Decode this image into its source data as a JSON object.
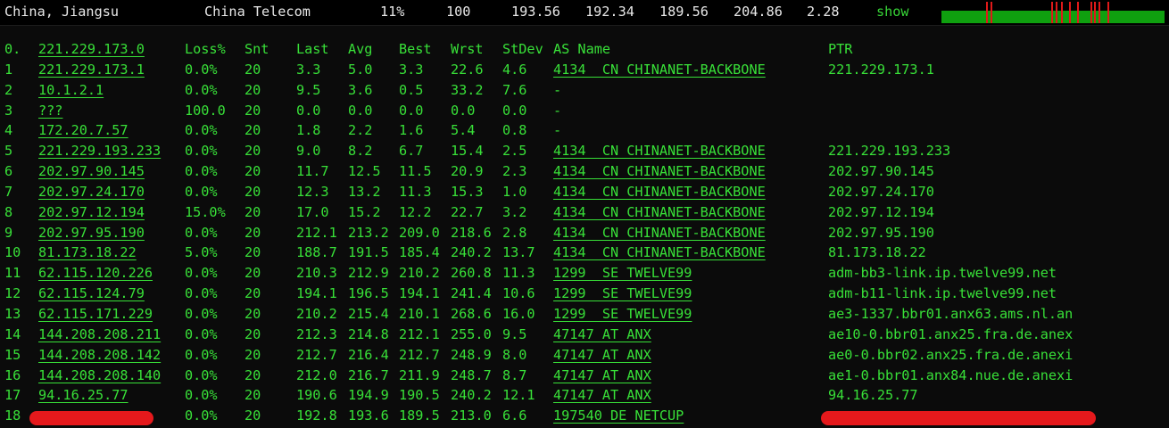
{
  "header": {
    "location": "China, Jiangsu",
    "isp": "China Telecom",
    "loss": "11%",
    "sent": "100",
    "last": "193.56",
    "avg": "192.34",
    "best": "189.56",
    "worst": "204.86",
    "stdev": "2.28",
    "show_label": "show"
  },
  "colors": {
    "text": "#38e038",
    "background": "#0b0b0b",
    "graph_ok": "#0fa00f",
    "graph_spike": "#e01919",
    "redaction": "#e5191c"
  },
  "columns": {
    "idx": "0.",
    "host": "221.229.173.0",
    "loss": "Loss%",
    "snt": "Snt",
    "last": "Last",
    "avg": "Avg",
    "best": "Best",
    "wrst": "Wrst",
    "stdev": "StDev",
    "as": "AS Name",
    "ptr": "PTR"
  },
  "hops": [
    {
      "idx": "1",
      "host": "221.229.173.1",
      "loss": "0.0%",
      "snt": "20",
      "last": "3.3",
      "avg": "5.0",
      "best": "3.3",
      "wrst": "22.6",
      "stdev": "4.6",
      "as": "4134  CN CHINANET-BACKBONE",
      "ptr": "221.229.173.1"
    },
    {
      "idx": "2",
      "host": "10.1.2.1",
      "loss": "0.0%",
      "snt": "20",
      "last": "9.5",
      "avg": "3.6",
      "best": "0.5",
      "wrst": "33.2",
      "stdev": "7.6",
      "as": "-",
      "ptr": ""
    },
    {
      "idx": "3",
      "host": "???",
      "loss": "100.0",
      "snt": "20",
      "last": "0.0",
      "avg": "0.0",
      "best": "0.0",
      "wrst": "0.0",
      "stdev": "0.0",
      "as": "-",
      "ptr": ""
    },
    {
      "idx": "4",
      "host": "172.20.7.57",
      "loss": "0.0%",
      "snt": "20",
      "last": "1.8",
      "avg": "2.2",
      "best": "1.6",
      "wrst": "5.4",
      "stdev": "0.8",
      "as": "-",
      "ptr": ""
    },
    {
      "idx": "5",
      "host": "221.229.193.233",
      "loss": "0.0%",
      "snt": "20",
      "last": "9.0",
      "avg": "8.2",
      "best": "6.7",
      "wrst": "15.4",
      "stdev": "2.5",
      "as": "4134  CN CHINANET-BACKBONE",
      "ptr": "221.229.193.233"
    },
    {
      "idx": "6",
      "host": "202.97.90.145",
      "loss": "0.0%",
      "snt": "20",
      "last": "11.7",
      "avg": "12.5",
      "best": "11.5",
      "wrst": "20.9",
      "stdev": "2.3",
      "as": "4134  CN CHINANET-BACKBONE",
      "ptr": "202.97.90.145"
    },
    {
      "idx": "7",
      "host": "202.97.24.170",
      "loss": "0.0%",
      "snt": "20",
      "last": "12.3",
      "avg": "13.2",
      "best": "11.3",
      "wrst": "15.3",
      "stdev": "1.0",
      "as": "4134  CN CHINANET-BACKBONE",
      "ptr": "202.97.24.170"
    },
    {
      "idx": "8",
      "host": "202.97.12.194",
      "loss": "15.0%",
      "snt": "20",
      "last": "17.0",
      "avg": "15.2",
      "best": "12.2",
      "wrst": "22.7",
      "stdev": "3.2",
      "as": "4134  CN CHINANET-BACKBONE",
      "ptr": "202.97.12.194"
    },
    {
      "idx": "9",
      "host": "202.97.95.190",
      "loss": "0.0%",
      "snt": "20",
      "last": "212.1",
      "avg": "213.2",
      "best": "209.0",
      "wrst": "218.6",
      "stdev": "2.8",
      "as": "4134  CN CHINANET-BACKBONE",
      "ptr": "202.97.95.190"
    },
    {
      "idx": "10",
      "host": "81.173.18.22",
      "loss": "5.0%",
      "snt": "20",
      "last": "188.7",
      "avg": "191.5",
      "best": "185.4",
      "wrst": "240.2",
      "stdev": "13.7",
      "as": "4134  CN CHINANET-BACKBONE",
      "ptr": "81.173.18.22"
    },
    {
      "idx": "11",
      "host": "62.115.120.226",
      "loss": "0.0%",
      "snt": "20",
      "last": "210.3",
      "avg": "212.9",
      "best": "210.2",
      "wrst": "260.8",
      "stdev": "11.3",
      "as": "1299  SE TWELVE99",
      "ptr": "adm-bb3-link.ip.twelve99.net"
    },
    {
      "idx": "12",
      "host": "62.115.124.79",
      "loss": "0.0%",
      "snt": "20",
      "last": "194.1",
      "avg": "196.5",
      "best": "194.1",
      "wrst": "241.4",
      "stdev": "10.6",
      "as": "1299  SE TWELVE99",
      "ptr": "adm-b11-link.ip.twelve99.net"
    },
    {
      "idx": "13",
      "host": "62.115.171.229",
      "loss": "0.0%",
      "snt": "20",
      "last": "210.2",
      "avg": "215.4",
      "best": "210.1",
      "wrst": "268.6",
      "stdev": "16.0",
      "as": "1299  SE TWELVE99",
      "ptr": "ae3-1337.bbr01.anx63.ams.nl.an"
    },
    {
      "idx": "14",
      "host": "144.208.208.211",
      "loss": "0.0%",
      "snt": "20",
      "last": "212.3",
      "avg": "214.8",
      "best": "212.1",
      "wrst": "255.0",
      "stdev": "9.5",
      "as": "47147 AT ANX",
      "ptr": "ae10-0.bbr01.anx25.fra.de.anex"
    },
    {
      "idx": "15",
      "host": "144.208.208.142",
      "loss": "0.0%",
      "snt": "20",
      "last": "212.7",
      "avg": "216.4",
      "best": "212.7",
      "wrst": "248.9",
      "stdev": "8.0",
      "as": "47147 AT ANX",
      "ptr": "ae0-0.bbr02.anx25.fra.de.anexi"
    },
    {
      "idx": "16",
      "host": "144.208.208.140",
      "loss": "0.0%",
      "snt": "20",
      "last": "212.0",
      "avg": "216.7",
      "best": "211.9",
      "wrst": "248.7",
      "stdev": "8.7",
      "as": "47147 AT ANX",
      "ptr": "ae1-0.bbr01.anx84.nue.de.anexi"
    },
    {
      "idx": "17",
      "host": "94.16.25.77",
      "loss": "0.0%",
      "snt": "20",
      "last": "190.6",
      "avg": "194.9",
      "best": "190.5",
      "wrst": "240.2",
      "stdev": "12.1",
      "as": "47147 AT ANX",
      "ptr": "94.16.25.77"
    },
    {
      "idx": "18",
      "host": "",
      "loss": "0.0%",
      "snt": "20",
      "last": "192.8",
      "avg": "193.6",
      "best": "189.5",
      "wrst": "213.0",
      "stdev": "6.6",
      "as": "197540 DE NETCUP",
      "ptr": "",
      "redacted": true
    }
  ]
}
